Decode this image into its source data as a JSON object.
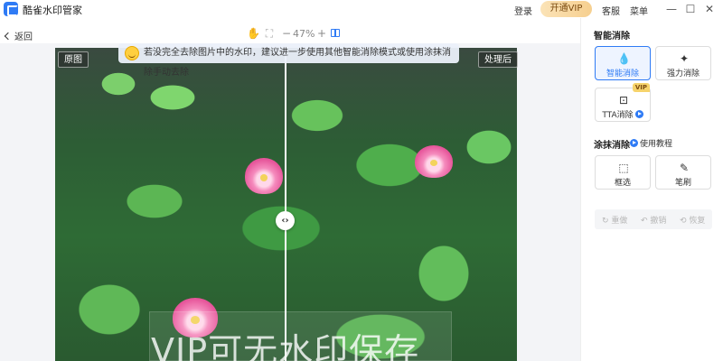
{
  "titlebar": {
    "app_name": "酷雀水印管家",
    "login": "登录",
    "vip": "开通VIP",
    "service": "客服",
    "menu": "菜单",
    "minimize": "—",
    "maximize": "☐",
    "close": "✕"
  },
  "toolbar": {
    "back": "返回",
    "hand_icon": "✋",
    "fit_icon": "⛶",
    "zoom_out": "−",
    "zoom": "47%",
    "zoom_in": "+"
  },
  "canvas": {
    "hint": "若没完全去除图片中的水印，建议进一步使用其他智能消除模式或使用涂抹消除手动去除",
    "original_label": "原图",
    "processed_label": "处理后",
    "watermark": "VIP可无水印保存",
    "divider_glyph": "‹›"
  },
  "panel": {
    "smart_title": "智能消除",
    "modes": [
      {
        "label": "智能消除",
        "icon": "💧"
      },
      {
        "label": "强力消除",
        "icon": "✦"
      },
      {
        "label": "TTA消除",
        "icon": "⊡",
        "badge": "VIP"
      }
    ],
    "brush_title": "涂抹消除",
    "tutorial": "使用教程",
    "tools": [
      {
        "label": "框选",
        "icon": "⬚"
      },
      {
        "label": "笔刷",
        "icon": "✎"
      }
    ],
    "history": {
      "redo": "重做",
      "undo": "撤销",
      "restore": "恢复"
    }
  }
}
